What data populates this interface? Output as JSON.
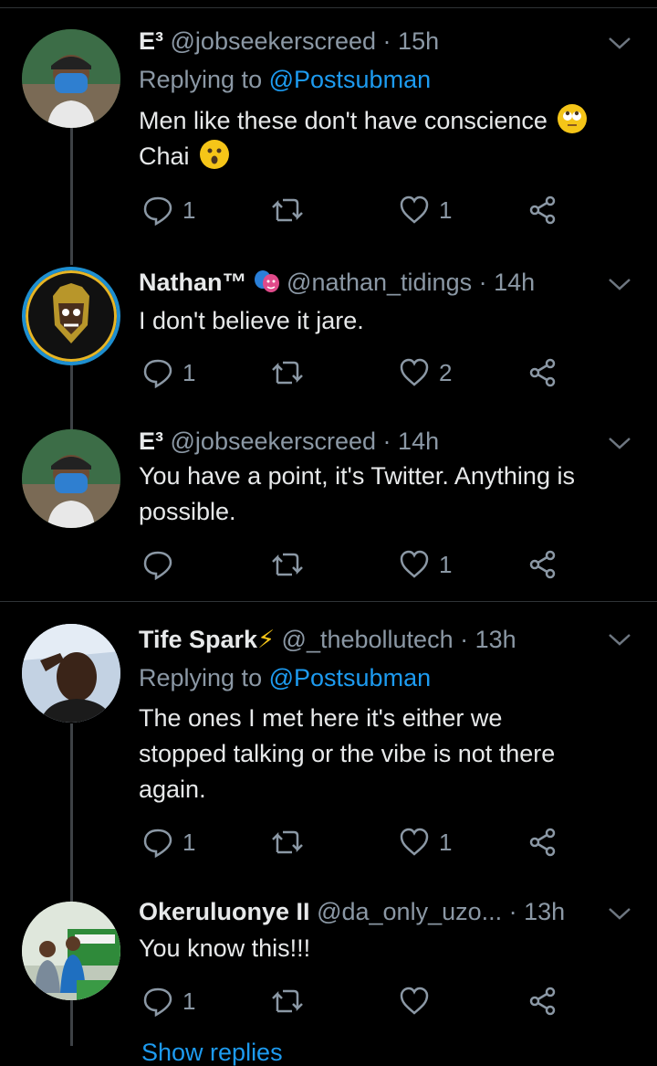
{
  "tweets": [
    {
      "name": "E³",
      "handle": "@jobseekerscreed",
      "time": "15h",
      "replying_prefix": "Replying to",
      "replying_to": "@Postsubman",
      "text_line1": "Men like these don't have conscience",
      "text_line2": "Chai",
      "replies": "1",
      "likes": "1",
      "emoji1": "eye-roll-emoji",
      "emoji2": "surprised-emoji"
    },
    {
      "name": "Nathan™",
      "handle": "@nathan_tidings",
      "time": "14h",
      "text_line1": "I don't believe it jare.",
      "replies": "1",
      "likes": "2"
    },
    {
      "name": "E³",
      "handle": "@jobseekerscreed",
      "time": "14h",
      "text_line1": "You have a point, it's Twitter. Anything is",
      "text_line2": "possible.",
      "likes": "1"
    },
    {
      "name": "Tife Spark",
      "handle": "@_thebollutech",
      "time": "13h",
      "replying_prefix": "Replying to",
      "replying_to": "@Postsubman",
      "text_line1": "The ones I met here it's either we",
      "text_line2": "stopped talking or the vibe is not there",
      "text_line3": "again.",
      "replies": "1",
      "likes": "1"
    },
    {
      "name": "Okeruluonye II",
      "handle": "@da_only_uzo...",
      "time": "13h",
      "text_line1": "You know this!!!",
      "replies": "1"
    }
  ],
  "dot": " · ",
  "show_replies": "Show replies",
  "colors": {
    "background": "#000000",
    "accent": "#1d9bf0",
    "secondary_text": "#8b98a5",
    "primary_text": "#e7e9ea"
  },
  "icons": [
    "reply-icon",
    "retweet-icon",
    "like-icon",
    "share-icon",
    "chevron-down-icon"
  ]
}
